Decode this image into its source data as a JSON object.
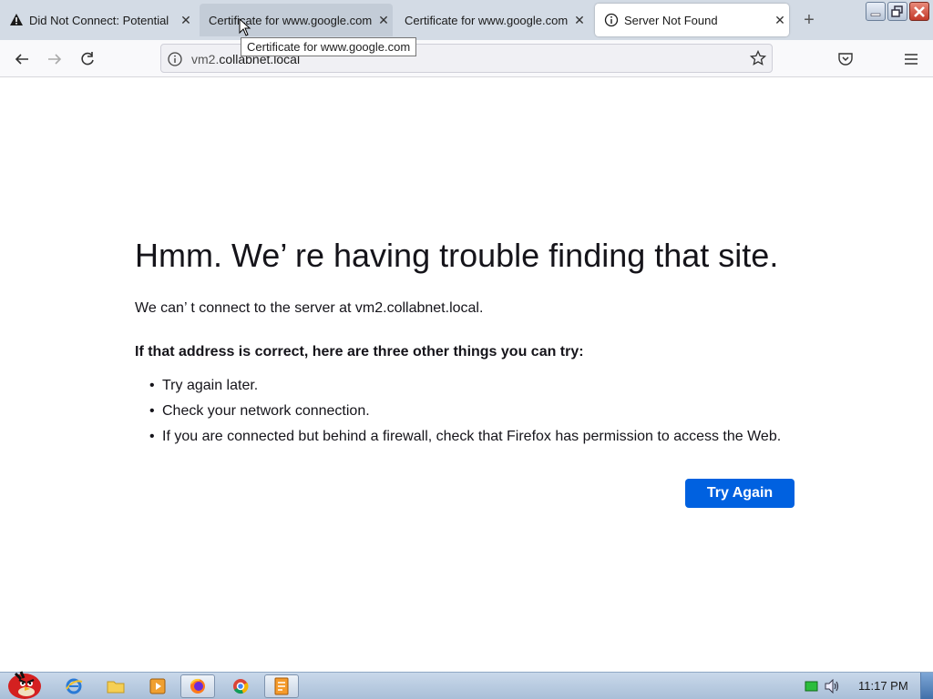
{
  "tabs": [
    {
      "title": "Did Not Connect: Potential",
      "icon": "warning-icon"
    },
    {
      "title": "Certificate for www.google.com",
      "icon": ""
    },
    {
      "title": "Certificate for www.google.com",
      "icon": ""
    },
    {
      "title": "Server Not Found",
      "icon": "info-icon"
    }
  ],
  "tooltip": "Certificate for www.google.com",
  "url": {
    "prefix": "vm2.",
    "host": "collabnet.local"
  },
  "error": {
    "heading": "Hmm. We’ re having trouble finding that site.",
    "message": "We can’ t connect to the server at vm2.collabnet.local.",
    "suggest_title": "If that address is correct, here are three other things you can try:",
    "suggestions": [
      "Try again later.",
      "Check your network connection.",
      "If you are connected but behind a firewall, check that Firefox has permission to access the Web."
    ],
    "button": "Try Again"
  },
  "taskbar": {
    "time": "11:17 PM"
  },
  "colors": {
    "accent": "#0061e0",
    "tabstrip": "#d3dbe5"
  }
}
